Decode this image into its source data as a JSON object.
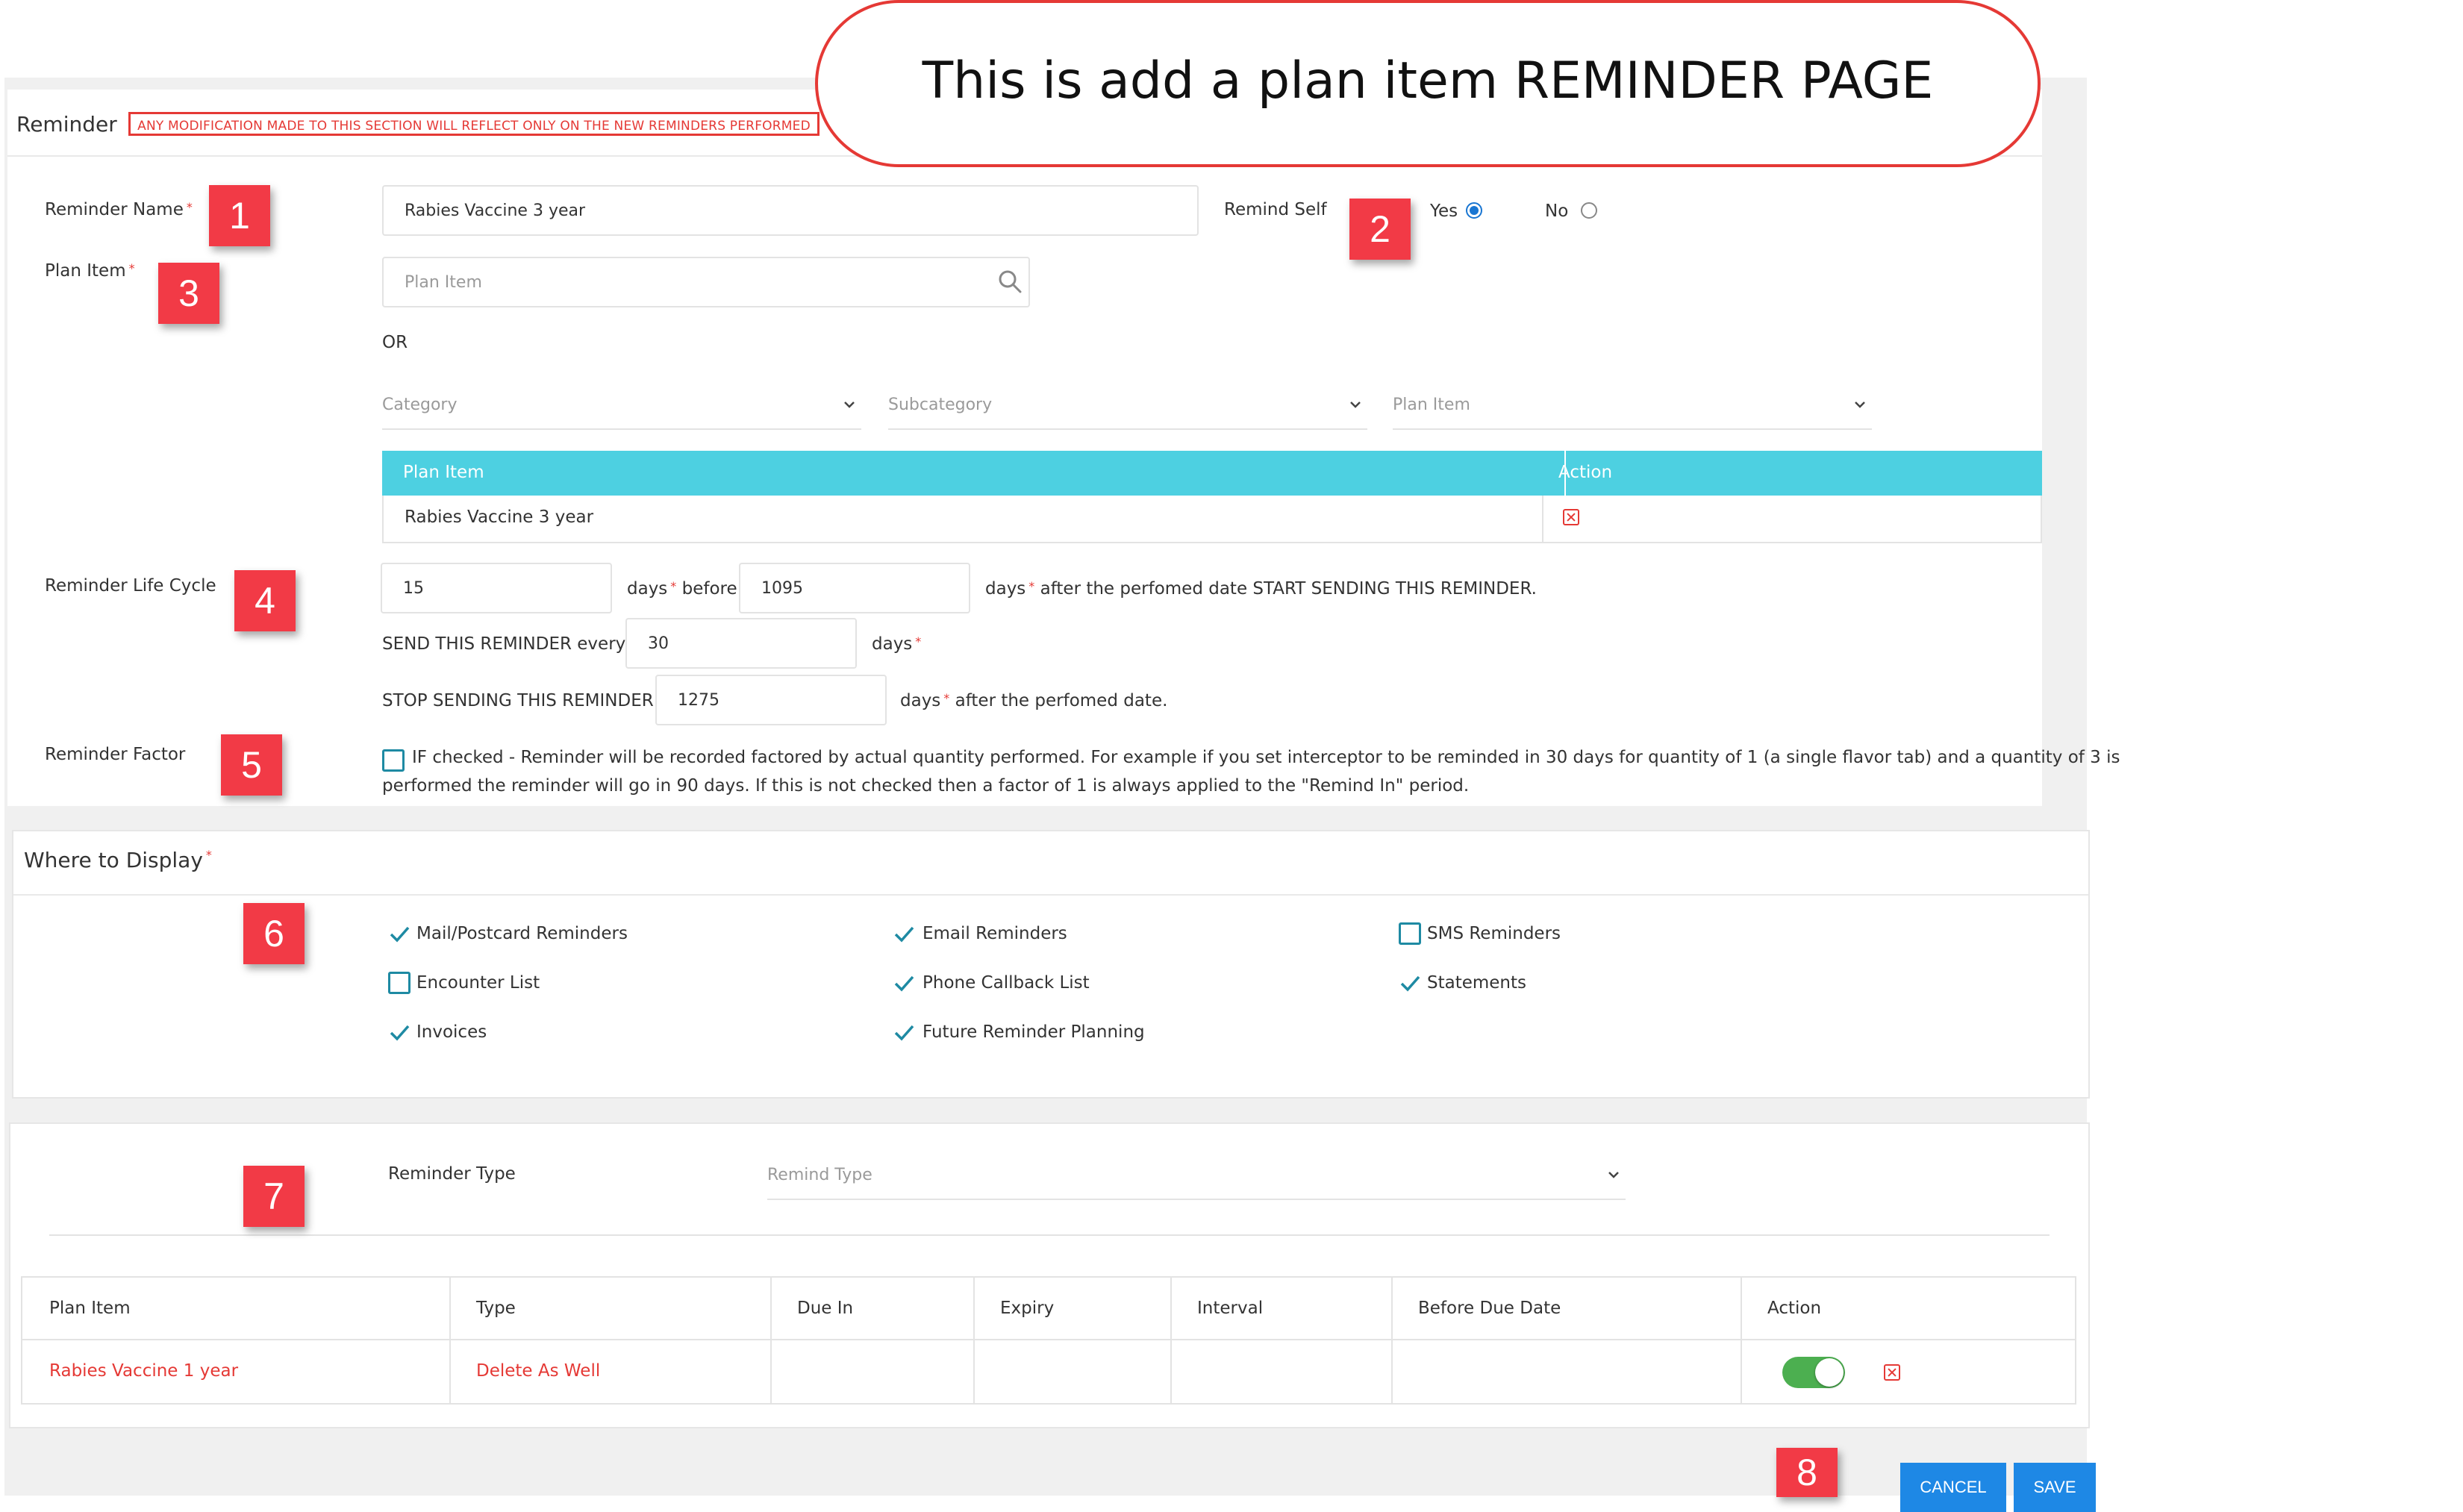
{
  "callout": "This is add a plan item REMINDER PAGE",
  "section1": {
    "title": "Reminder",
    "warning": "ANY MODIFICATION MADE TO THIS SECTION WILL REFLECT ONLY ON THE NEW REMINDERS PERFORMED"
  },
  "form": {
    "reminder_name_label": "Reminder Name",
    "reminder_name_value": "Rabies Vaccine 3 year",
    "remind_self_label": "Remind Self",
    "remind_self_yes": "Yes",
    "remind_self_no": "No",
    "remind_self_selected": "Yes",
    "plan_item_label": "Plan Item",
    "plan_item_placeholder": "Plan Item",
    "or_text": "OR",
    "category_placeholder": "Category",
    "subcategory_placeholder": "Subcategory",
    "plan_item_select_placeholder": "Plan Item",
    "required_mark": "*"
  },
  "plan_table": {
    "headers": [
      "Plan Item",
      "Action"
    ],
    "rows": [
      {
        "plan_item": "Rabies Vaccine 3 year"
      }
    ]
  },
  "life_cycle": {
    "label": "Reminder Life Cycle",
    "before_value": "15",
    "days_before_text": "days",
    "before_word": "before",
    "after_value": "1095",
    "after_text": "days",
    "after_suffix": "after the perfomed date START SENDING THIS REMINDER.",
    "send_every_label": "SEND THIS REMINDER every",
    "send_every_value": "30",
    "send_every_unit": "days",
    "stop_label": "STOP SENDING THIS REMINDER",
    "stop_value": "1275",
    "stop_unit": "days",
    "stop_suffix": "after the perfomed date."
  },
  "factor": {
    "label": "Reminder Factor",
    "text_line1": "IF checked - Reminder will be recorded factored by actual quantity performed. For example if you set interceptor to be reminded in 30 days for quantity of 1 (a single flavor tab) and a quantity of 3 is",
    "text_line2": "performed the reminder will go in 90 days. If this is not checked then a factor of 1 is always applied to the \"Remind In\" period.",
    "checked": false
  },
  "display": {
    "title": "Where to Display",
    "options": [
      {
        "label": "Mail/Postcard Reminders",
        "checked": true
      },
      {
        "label": "Email Reminders",
        "checked": true
      },
      {
        "label": "SMS Reminders",
        "checked": false
      },
      {
        "label": "Encounter List",
        "checked": false
      },
      {
        "label": "Phone Callback List",
        "checked": true
      },
      {
        "label": "Statements",
        "checked": true
      },
      {
        "label": "Invoices",
        "checked": true
      },
      {
        "label": "Future Reminder Planning",
        "checked": true
      }
    ]
  },
  "reminder_type": {
    "label": "Reminder Type",
    "placeholder": "Remind Type"
  },
  "type_table": {
    "headers": [
      "Plan Item",
      "Type",
      "Due In",
      "Expiry",
      "Interval",
      "Before Due Date",
      "Action"
    ],
    "rows": [
      {
        "plan_item": "Rabies Vaccine 1 year",
        "type": "Delete As Well",
        "due_in": "",
        "expiry": "",
        "interval": "",
        "before_due": "",
        "enabled": true
      }
    ]
  },
  "buttons": {
    "cancel": "CANCEL",
    "save": "SAVE"
  },
  "badges": [
    "1",
    "2",
    "3",
    "4",
    "5",
    "6",
    "7",
    "8"
  ],
  "colors": {
    "accent": "#4dd0e1",
    "danger": "#e53935",
    "primary": "#1e88e5",
    "badge": "#f23a46",
    "toggle": "#4caf50",
    "check": "#1e8aa3"
  }
}
